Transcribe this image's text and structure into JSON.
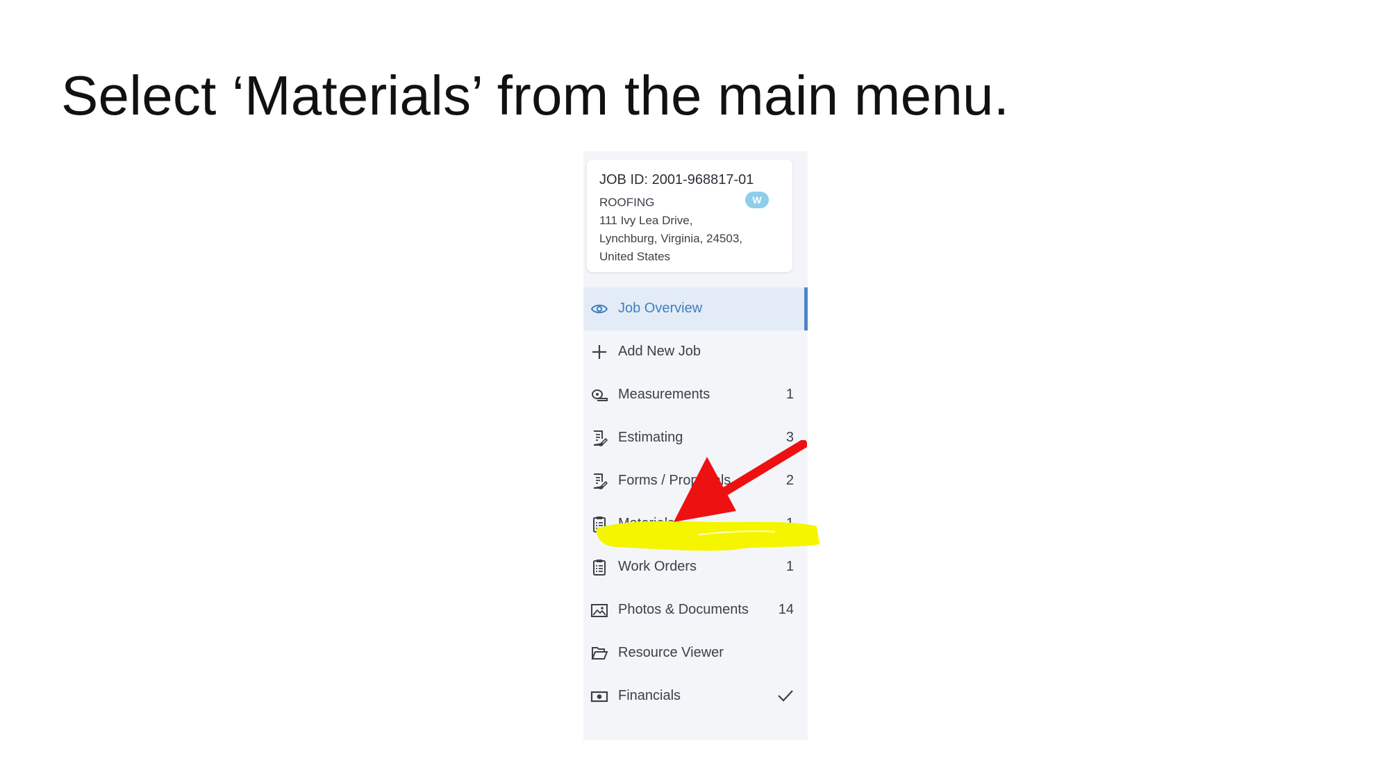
{
  "slide": {
    "title": "Select ‘Materials’ from the main menu."
  },
  "job_card": {
    "job_id": "JOB ID: 2001-968817-01",
    "type": "ROOFING",
    "badge": "W",
    "address_line1": "111 Ivy Lea Drive,",
    "address_line2": "Lynchburg, Virginia, 24503,",
    "address_line3": "United States"
  },
  "menu": {
    "items": [
      {
        "label": "Job Overview",
        "count": "",
        "icon": "eye-icon",
        "active": true
      },
      {
        "label": "Add New Job",
        "count": "",
        "icon": "plus-icon"
      },
      {
        "label": "Measurements",
        "count": "1",
        "icon": "measuring-tape-icon"
      },
      {
        "label": "Estimating",
        "count": "3",
        "icon": "document-edit-icon"
      },
      {
        "label": "Forms / Proposals",
        "count": "2",
        "icon": "document-edit-icon"
      },
      {
        "label": "Materials",
        "count": "1",
        "icon": "clipboard-list-icon",
        "highlighted": true
      },
      {
        "label": "Work Orders",
        "count": "1",
        "icon": "clipboard-list-icon"
      },
      {
        "label": "Photos & Documents",
        "count": "14",
        "icon": "image-icon"
      },
      {
        "label": "Resource Viewer",
        "count": "",
        "icon": "folder-open-icon"
      },
      {
        "label": "Financials",
        "count": "",
        "icon": "money-icon",
        "status": "checkmark-icon"
      }
    ]
  },
  "colors": {
    "active_bg": "#e3ecf6",
    "active_text": "#3f7fbf",
    "active_bar": "#4a86c5",
    "highlight": "#f5f500",
    "arrow": "#ee1111",
    "badge": "#8fcdea"
  }
}
